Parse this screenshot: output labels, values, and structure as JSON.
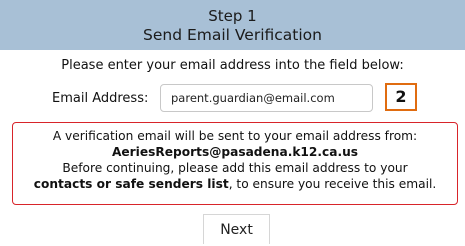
{
  "header": {
    "step": "Step 1",
    "title": "Send Email Verification"
  },
  "form": {
    "instruction": "Please enter your email address into the field below:",
    "email_label": "Email Address:",
    "email_value": "parent.guardian@email.com",
    "step_badge": "2"
  },
  "notice": {
    "line1": "A verification email will be sent to your email address from:",
    "sender": "AeriesReports@pasadena.k12.ca.us",
    "line3": "Before continuing, please add this email address to your",
    "line4_bold": "contacts or safe senders list",
    "line4_rest": ", to ensure you receive this email."
  },
  "actions": {
    "next_label": "Next"
  },
  "colors": {
    "header_bg": "#a8c0d6",
    "notice_border": "#d8242a",
    "badge_border": "#e06c10"
  }
}
